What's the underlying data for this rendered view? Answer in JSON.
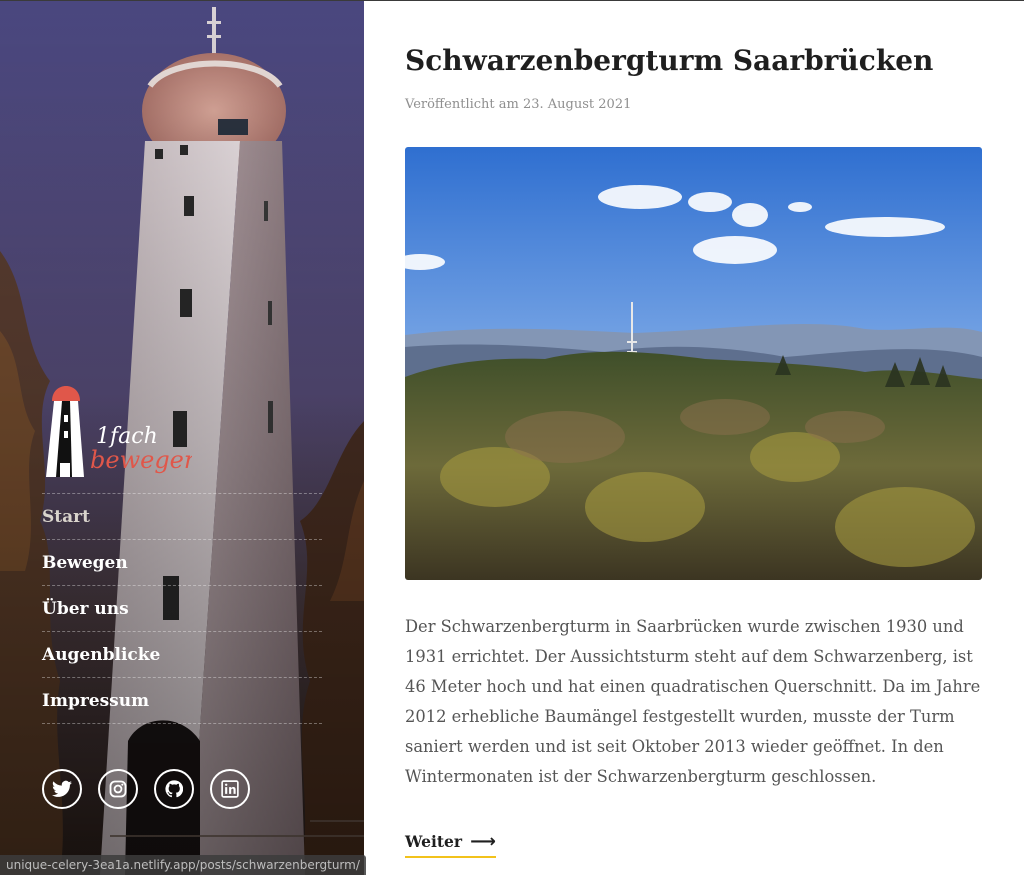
{
  "site": {
    "logo_text_1": "1fach",
    "logo_text_2": "bewegen"
  },
  "nav": {
    "items": [
      {
        "label": "Start",
        "active": true
      },
      {
        "label": "Bewegen",
        "active": false
      },
      {
        "label": "Über uns",
        "active": false
      },
      {
        "label": "Augenblicke",
        "active": false
      },
      {
        "label": "Impressum",
        "active": false
      }
    ]
  },
  "social": [
    "twitter-icon",
    "instagram-icon",
    "github-icon",
    "linkedin-icon"
  ],
  "status": {
    "url": "unique-celery-3ea1a.netlify.app/posts/schwarzenbergturm/"
  },
  "post": {
    "title": "Schwarzenbergturm Saarbrücken",
    "published": "Veröffentlicht am 23. August 2021",
    "excerpt": "Der Schwarzenbergturm in Saarbrücken wurde zwischen 1930 und 1931 errichtet. Der Aussichtsturm steht auf dem Schwarzenberg, ist 46 Meter hoch und hat einen quadratischen Querschnitt. Da im Jahre 2012 erhebliche Baumängel festgestellt wurden, musste der Turm saniert werden und ist seit Oktober 2013 wieder geöffnet. In den Wintermonaten ist der Schwarzenbergturm geschlossen.",
    "read_more": "Weiter",
    "arrow": "⟶"
  },
  "colors": {
    "accent": "#f2c21b",
    "title": "#1f1f1f",
    "logo_red": "#e0574a"
  }
}
